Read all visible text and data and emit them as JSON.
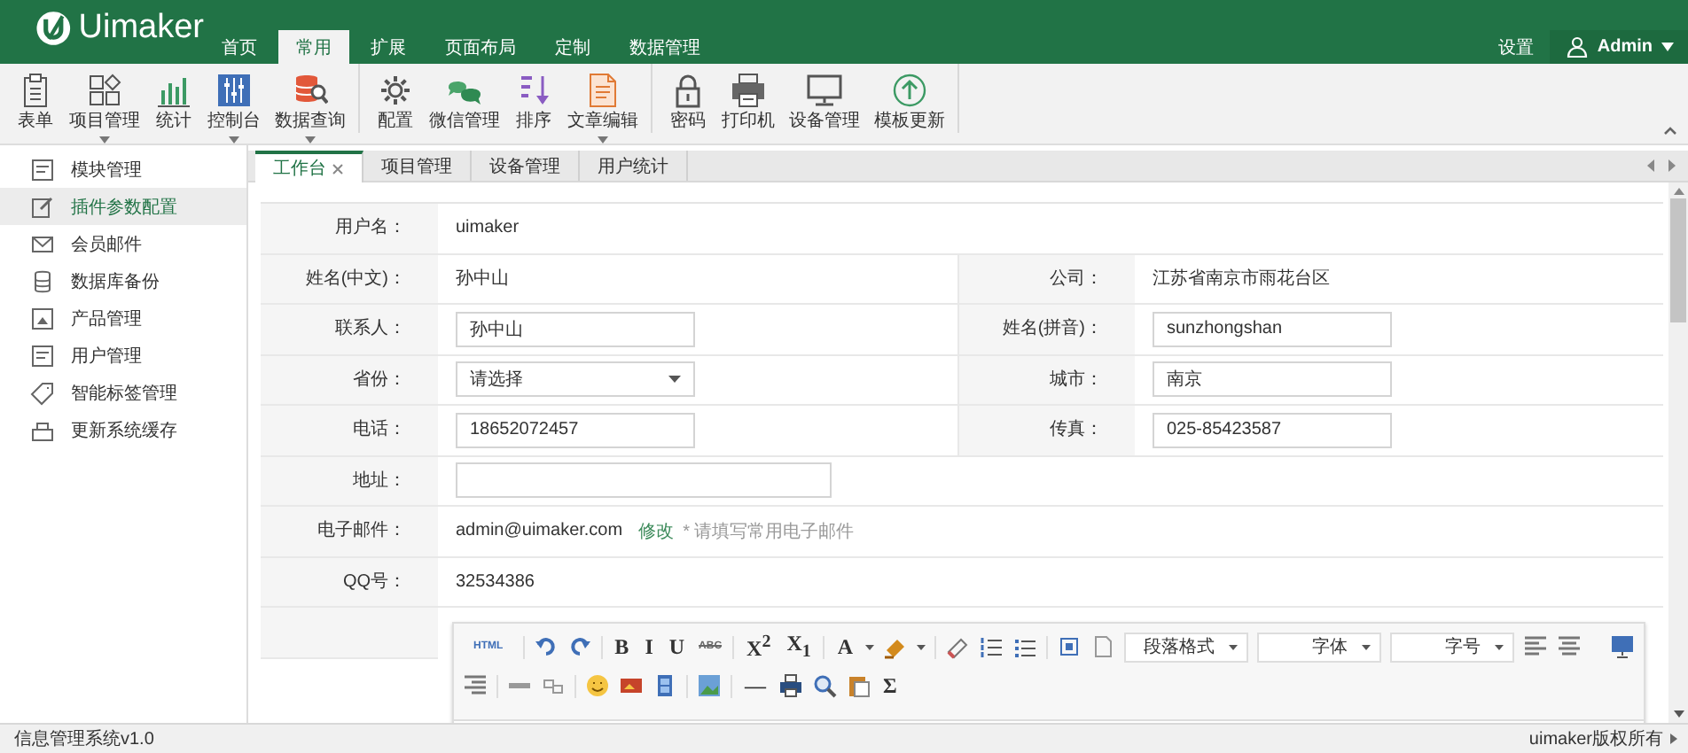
{
  "app": {
    "logo": "Uimaker"
  },
  "nav": [
    {
      "label": "首页",
      "selected": false
    },
    {
      "label": "常用",
      "selected": true
    },
    {
      "label": "扩展",
      "selected": false
    },
    {
      "label": "页面布局",
      "selected": false
    },
    {
      "label": "定制",
      "selected": false
    },
    {
      "label": "数据管理",
      "selected": false
    }
  ],
  "header_links": {
    "settings": "设置",
    "user": "Admin"
  },
  "toolbar": {
    "groups": [
      [
        {
          "label": "表单",
          "dropdown": false
        },
        {
          "label": "项目管理",
          "dropdown": true
        },
        {
          "label": "统计",
          "dropdown": false
        },
        {
          "label": "控制台",
          "dropdown": true
        },
        {
          "label": "数据查询",
          "dropdown": true
        }
      ],
      [
        {
          "label": "配置",
          "dropdown": false
        },
        {
          "label": "微信管理",
          "dropdown": false
        },
        {
          "label": "排序",
          "dropdown": false
        },
        {
          "label": "文章编辑",
          "dropdown": true
        }
      ],
      [
        {
          "label": "密码",
          "dropdown": false
        },
        {
          "label": "打印机",
          "dropdown": false
        },
        {
          "label": "设备管理",
          "dropdown": false
        },
        {
          "label": "模板更新",
          "dropdown": false
        }
      ]
    ]
  },
  "sidebar": {
    "items": [
      {
        "label": "模块管理",
        "selected": false
      },
      {
        "label": "插件参数配置",
        "selected": true
      },
      {
        "label": "会员邮件",
        "selected": false
      },
      {
        "label": "数据库备份",
        "selected": false
      },
      {
        "label": "产品管理",
        "selected": false
      },
      {
        "label": "用户管理",
        "selected": false
      },
      {
        "label": "智能标签管理",
        "selected": false
      },
      {
        "label": "更新系统缓存",
        "selected": false
      }
    ]
  },
  "tabs": [
    {
      "label": "工作台",
      "selected": true,
      "closable": true
    },
    {
      "label": "项目管理",
      "selected": false,
      "closable": false
    },
    {
      "label": "设备管理",
      "selected": false,
      "closable": false
    },
    {
      "label": "用户统计",
      "selected": false,
      "closable": false
    }
  ],
  "form": {
    "rows": [
      {
        "fields": [
          {
            "label": "用户名：",
            "kind": "text",
            "value": "uimaker"
          }
        ]
      },
      {
        "fields": [
          {
            "label": "姓名(中文)：",
            "kind": "text",
            "value": "孙中山"
          },
          {
            "label": "公司：",
            "kind": "text",
            "value": "江苏省南京市雨花台区"
          }
        ]
      },
      {
        "fields": [
          {
            "label": "联系人：",
            "kind": "input",
            "value": "孙中山"
          },
          {
            "label": "姓名(拼音)：",
            "kind": "input",
            "value": "sunzhongshan"
          }
        ]
      },
      {
        "fields": [
          {
            "label": "省份：",
            "kind": "select",
            "value": "请选择"
          },
          {
            "label": "城市：",
            "kind": "input",
            "value": "南京"
          }
        ]
      },
      {
        "fields": [
          {
            "label": "电话：",
            "kind": "input",
            "value": "18652072457"
          },
          {
            "label": "传真：",
            "kind": "input",
            "value": "025-85423587"
          }
        ]
      },
      {
        "fields": [
          {
            "label": "地址：",
            "kind": "input_wide"
          }
        ]
      },
      {
        "fields": [
          {
            "label": "电子邮件：",
            "kind": "email",
            "value": "admin@uimaker.com",
            "link": "修改",
            "hint": "* 请填写常用电子邮件"
          }
        ]
      },
      {
        "fields": [
          {
            "label": "QQ号：",
            "kind": "text",
            "value": "32534386"
          }
        ]
      },
      {
        "fields": [
          {
            "kind": "editor"
          }
        ]
      }
    ]
  },
  "editor": {
    "toolbar": [
      [
        {
          "kind": "tiny",
          "label": "HTML"
        },
        {
          "kind": "sep"
        },
        {
          "kind": "icon"
        },
        {
          "kind": "icon"
        },
        {
          "kind": "sep"
        },
        {
          "kind": "glyph",
          "label": "B"
        },
        {
          "kind": "glyph",
          "label": "I"
        },
        {
          "kind": "glyph",
          "label": "U"
        },
        {
          "kind": "tiny",
          "label": "ABC"
        },
        {
          "kind": "sep"
        },
        {
          "kind": "glyph",
          "label": "X$^{2}$"
        },
        {
          "kind": "glyph",
          "label": "X$_{1}$"
        },
        {
          "kind": "sep"
        },
        {
          "kind": "glyph",
          "label": "A"
        },
        {
          "kind": "caret"
        },
        {
          "kind": "icon"
        },
        {
          "kind": "caret"
        },
        {
          "kind": "sep"
        },
        {
          "kind": "icon"
        },
        {
          "kind": "icon"
        },
        {
          "kind": "icon"
        },
        {
          "kind": "sep"
        },
        {
          "kind": "icon"
        },
        {
          "kind": "icon"
        },
        {
          "kind": "select",
          "label": "段落格式"
        },
        {
          "kind": "select",
          "label": "字体"
        },
        {
          "kind": "select",
          "label": "字号"
        },
        {
          "kind": "icon"
        },
        {
          "kind": "icon"
        },
        {
          "kind": "gap"
        },
        {
          "kind": "icon"
        }
      ],
      [
        {
          "kind": "icon"
        },
        {
          "kind": "sep"
        },
        {
          "kind": "icon"
        },
        {
          "kind": "icon"
        },
        {
          "kind": "sep"
        },
        {
          "kind": "icon"
        },
        {
          "kind": "icon"
        },
        {
          "kind": "icon"
        },
        {
          "kind": "sep"
        },
        {
          "kind": "icon"
        },
        {
          "kind": "sep"
        },
        {
          "kind": "glyph",
          "label": "—"
        },
        {
          "kind": "icon"
        },
        {
          "kind": "icon"
        },
        {
          "kind": "icon"
        },
        {
          "kind": "glyph",
          "label": "Σ"
        }
      ]
    ]
  },
  "status_bar": {
    "left": "信息管理系统v1.0",
    "right": "uimaker版权所有"
  }
}
